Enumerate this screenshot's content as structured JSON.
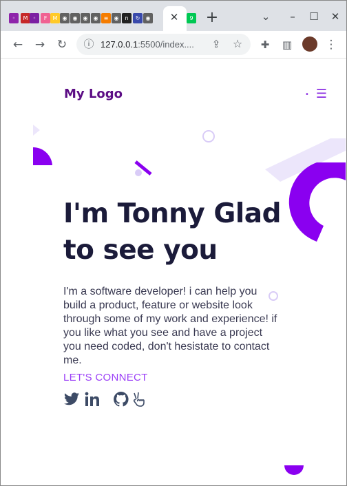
{
  "browser": {
    "tab_close_glyph": "✕",
    "new_tab_glyph": "+",
    "tab_icons": [
      {
        "name": "tab-icon-1",
        "color": "#8e24aa",
        "glyph": "◦"
      },
      {
        "name": "tab-icon-2",
        "color": "#c62828",
        "glyph": "M"
      },
      {
        "name": "tab-icon-3",
        "color": "#7b1fa2",
        "glyph": "◦"
      },
      {
        "name": "tab-icon-4",
        "color": "#f06292",
        "glyph": "F"
      },
      {
        "name": "tab-icon-5",
        "color": "#ffca28",
        "glyph": "M"
      },
      {
        "name": "tab-icon-6",
        "color": "#616161",
        "glyph": "◉"
      },
      {
        "name": "tab-icon-7",
        "color": "#616161",
        "glyph": "◉"
      },
      {
        "name": "tab-icon-8",
        "color": "#616161",
        "glyph": "◉"
      },
      {
        "name": "tab-icon-9",
        "color": "#616161",
        "glyph": "◉"
      },
      {
        "name": "tab-icon-10",
        "color": "#f57c00",
        "glyph": "≡"
      },
      {
        "name": "tab-icon-11",
        "color": "#616161",
        "glyph": "◉"
      },
      {
        "name": "tab-icon-12",
        "color": "#212121",
        "glyph": "n"
      },
      {
        "name": "tab-icon-13",
        "color": "#3949ab",
        "glyph": "↻"
      },
      {
        "name": "tab-icon-14",
        "color": "#616161",
        "glyph": "◉"
      }
    ],
    "extra_tab_icon": {
      "color": "#00c853",
      "glyph": "9"
    },
    "window_controls": {
      "chevron": "⌄",
      "minimize": "–",
      "maximize": "☐",
      "close": "✕"
    },
    "nav": {
      "back": "←",
      "forward": "→",
      "reload": "↻",
      "info": "ⓘ",
      "share": "⇪",
      "star": "☆",
      "extensions": "✚",
      "sidepanel": "▥",
      "more": "⋮"
    },
    "url_host": "127.0.0.1",
    "url_rest": ":5500/index....",
    "accent": "#9b3ff7"
  },
  "page": {
    "logo": "My Logo",
    "menu_glyph": "☰",
    "menu_dot": "•",
    "hero_line1": "I'm Tonny Glad",
    "hero_line2": "to see you",
    "intro": "I'm a software developer! i can help you build a product, feature or website look through some of my work and experience! if you like what you see and have a project you need coded, don't hesistate to contact me.",
    "cta": "LET'S CONNECT",
    "socials": [
      "twitter-icon",
      "linkedin-icon",
      "github-icon",
      "peace-hand-icon"
    ],
    "colors": {
      "logo": "#5c0d85",
      "title": "#1b1b3a",
      "text": "#3a3a52",
      "purple": "#8a00f0",
      "lavender": "#ece6fb"
    }
  }
}
